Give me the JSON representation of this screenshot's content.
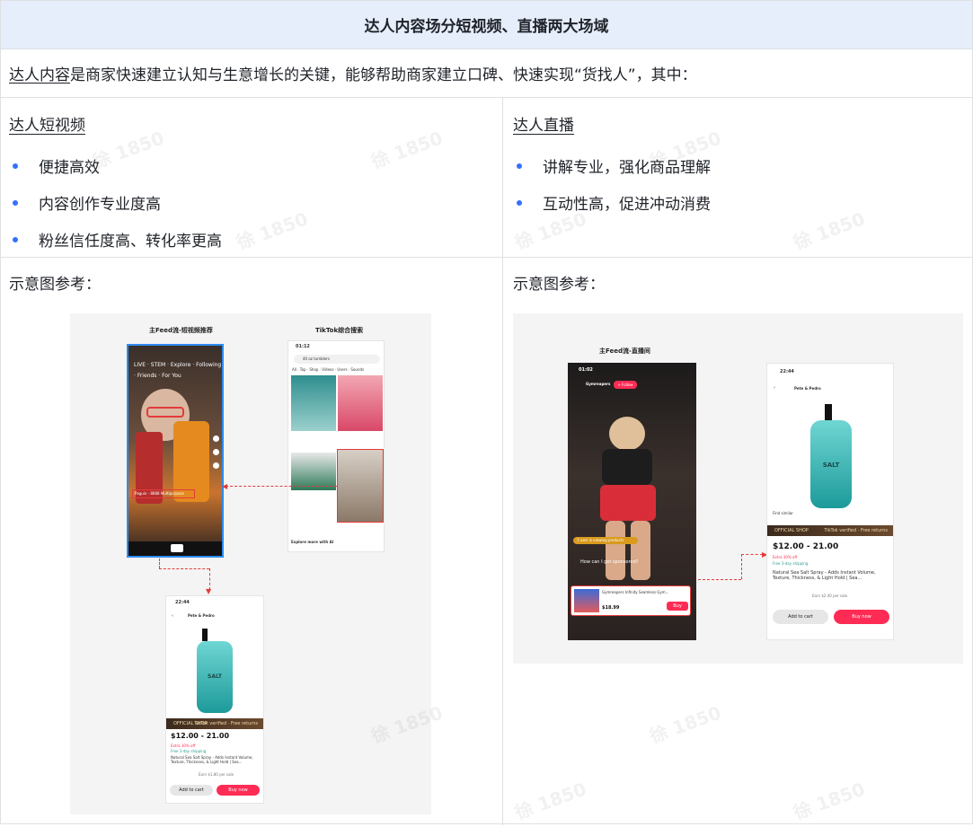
{
  "header": {
    "title": "达人内容场分短视频、直播两大场域"
  },
  "intro": {
    "lead_underlined": "达人内容",
    "rest": "是商家快速建立认知与生意增长的关键，能够帮助商家建立口碑、快速实现“货找人”，其中："
  },
  "left": {
    "title": "达人短视频",
    "bullets": [
      "便捷高效",
      "内容创作专业度高",
      "粉丝信任度高、转化率更高"
    ],
    "ref_label": "示意图参考：",
    "figure": {
      "cap_feed": "主Feed流-短视频推荐",
      "cap_search": "TikTok综合搜索",
      "search_placeholder": "40 oz tumblers",
      "search_tabs": [
        "All",
        "Top",
        "Shop",
        "Videos",
        "Users",
        "Sounds"
      ],
      "time1": "01:12",
      "time2": "22:44",
      "brand": "Pete & Pedro",
      "shop_label": "OFFICIAL SHOP",
      "shop_tag": "TikTok verified · Free returns",
      "price": "$12.00 - 21.00",
      "promo": "Extra 30% off",
      "shipping": "Free 3-day shipping",
      "product": "Natural Sea Salt Spray - Adds Instant Volume, Texture, Thickness, & Light Hold | Sea...",
      "earn": "Earn $1.80 per sale",
      "add_to_cart": "Add to cart",
      "buy_now": "Buy now",
      "explore": "Explore more with AI",
      "video_product": "Paguin - 8888 Multipurpose Products"
    }
  },
  "right": {
    "title": "达人直播",
    "bullets": [
      "讲解专业，强化商品理解",
      "互动性高，促进冲动消费"
    ],
    "ref_label": "示意图参考：",
    "figure": {
      "cap_live": "主Feed流-直播间",
      "time1": "01:02",
      "time2": "22:44",
      "host": "Gymreapers",
      "follow": "+ Follow",
      "viewing": "1 user is viewing products",
      "comment": "How can I get sponsored?",
      "live_product": "Gymreapers Infinity Seamless Gym...",
      "live_price": "$18.99",
      "buy": "Buy",
      "brand": "Pete & Pedro",
      "shop_label": "OFFICIAL SHOP",
      "shop_tag": "TikTok verified · Free returns",
      "price": "$12.00 - 21.00",
      "promo": "Extra 30% off",
      "shipping": "Free 3-day shipping",
      "product": "Natural Sea Salt Spray - Adds Instant Volume, Texture, Thickness, & Light Hold | Sea...",
      "earn": "Earn $2.40 per sale",
      "add_to_cart": "Add to cart",
      "buy_now": "Buy now",
      "find_similar": "Find similar"
    }
  },
  "colors": {
    "header_bg": "#e6edfb",
    "bullet": "#3370ff",
    "highlight": "#e23b3b",
    "tiktok_red": "#fe2c55"
  }
}
